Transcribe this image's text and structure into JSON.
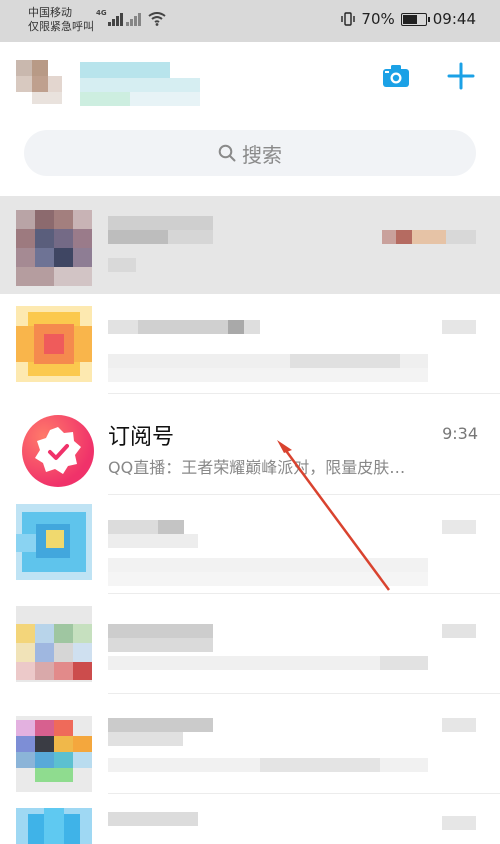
{
  "status_bar": {
    "carrier_line1": "中国移动",
    "carrier_line2": "仅限紧急呼叫",
    "network": "4G",
    "battery": "70%",
    "battery_level": 0.7,
    "time": "09:44"
  },
  "header": {
    "camera_icon": "camera-icon",
    "add_icon": "plus-icon"
  },
  "search": {
    "placeholder": "搜索",
    "icon": "search-icon"
  },
  "conversations": [
    {
      "title": "订阅号",
      "time": "9:34",
      "preview": "QQ直播：王者荣耀巅峰派对，限量皮肤…"
    }
  ],
  "colors": {
    "accent": "#1ba1e6",
    "annotation_arrow": "#d9432f",
    "badge_gradient_start": "#ff7a6a",
    "badge_gradient_end": "#f0326a"
  }
}
